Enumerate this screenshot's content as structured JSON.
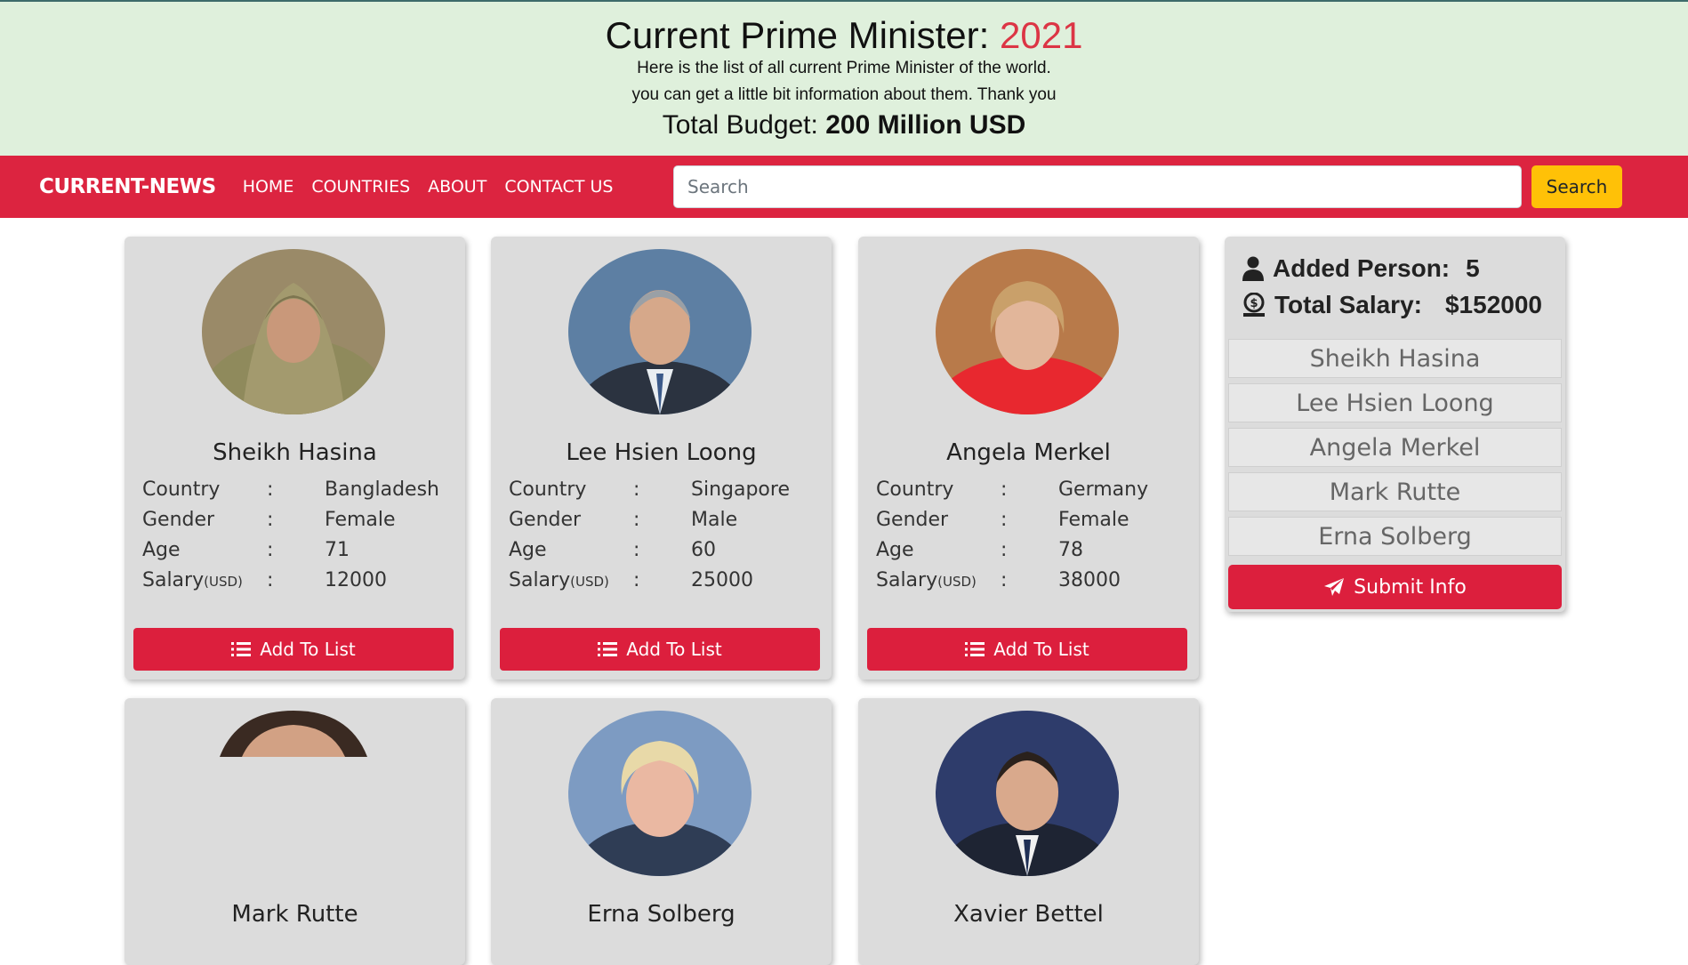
{
  "header": {
    "title_prefix": "Current Prime Minister:",
    "year": "2021",
    "line1": "Here is the list of all current Prime Minister of the world.",
    "line2": "you can get a little bit information about them. Thank you",
    "budget_label": "Total Budget:",
    "budget_value": "200 Million USD"
  },
  "navbar": {
    "brand": "CURRENT-NEWS",
    "links": [
      "HOME",
      "COUNTRIES",
      "ABOUT",
      "CONTACT US"
    ],
    "search_placeholder": "Search",
    "search_button": "Search"
  },
  "field_labels": {
    "country": "Country",
    "gender": "Gender",
    "age": "Age",
    "salary": "Salary",
    "salary_unit": "(USD)",
    "colon": ":"
  },
  "add_button_label": "Add To List",
  "cards": [
    {
      "name": "Sheikh Hasina",
      "country": "Bangladesh",
      "gender": "Female",
      "age": "71",
      "salary": "12000"
    },
    {
      "name": "Lee Hsien Loong",
      "country": "Singapore",
      "gender": "Male",
      "age": "60",
      "salary": "25000"
    },
    {
      "name": "Angela Merkel",
      "country": "Germany",
      "gender": "Female",
      "age": "78",
      "salary": "38000"
    },
    {
      "name": "Mark Rutte"
    },
    {
      "name": "Erna Solberg"
    },
    {
      "name": "Xavier Bettel"
    }
  ],
  "summary": {
    "added_label": "Added Person:",
    "added_count": "5",
    "salary_label": "Total Salary:",
    "salary_total": "$152000",
    "list": [
      "Sheikh Hasina",
      "Lee Hsien Loong",
      "Angela Merkel",
      "Mark Rutte",
      "Erna Solberg"
    ],
    "submit_label": "Submit Info"
  },
  "colors": {
    "hero_bg": "#dff0dc",
    "navbar_bg": "#dc2440",
    "accent_red": "#dc1f3d",
    "search_button_bg": "#ffc107",
    "card_bg": "#dcdcdc"
  }
}
